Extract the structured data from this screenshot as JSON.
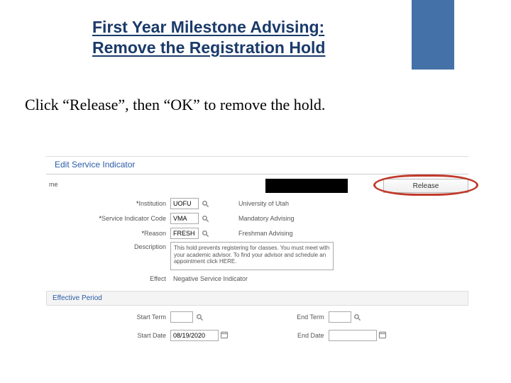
{
  "slide": {
    "title_line1": "First Year Milestone Advising:",
    "title_line2": "Remove the Registration Hold",
    "instruction": "Click “Release”, then “OK” to remove the hold."
  },
  "app": {
    "header": "Edit Service Indicator",
    "top": {
      "me_label": "me",
      "release_label": "Release"
    },
    "fields": {
      "institution_label": "*Institution",
      "institution_value": "UOFU",
      "institution_display": "University of Utah",
      "sic_label": "*Service Indicator Code",
      "sic_value": "VMA",
      "sic_display": "Mandatory Advising",
      "reason_label": "*Reason",
      "reason_value": "FRESH",
      "reason_display": "Freshman Advising",
      "description_label": "Description",
      "description_value": "This hold prevents registering for classes. You must meet with your academic advisor. To find your advisor and schedule an appointment click HERE.",
      "effect_label": "Effect",
      "effect_value": "Negative Service Indicator"
    },
    "effective": {
      "section_title": "Effective Period",
      "start_term_label": "Start Term",
      "start_term_value": "",
      "end_term_label": "End Term",
      "end_term_value": "",
      "start_date_label": "Start Date",
      "start_date_value": "08/19/2020",
      "end_date_label": "End Date",
      "end_date_value": ""
    }
  }
}
